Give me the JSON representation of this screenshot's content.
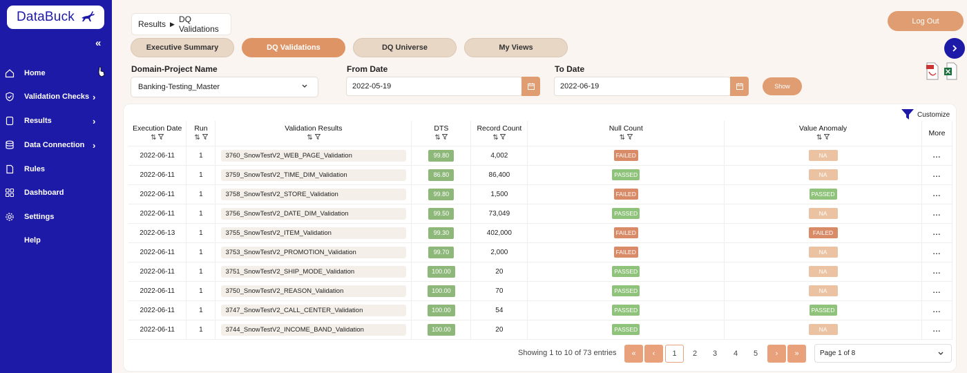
{
  "logo": {
    "text": "DataBuck"
  },
  "sidebar": {
    "items": [
      {
        "label": "Home",
        "has_chevron": false
      },
      {
        "label": "Validation Checks",
        "has_chevron": true
      },
      {
        "label": "Results",
        "has_chevron": true
      },
      {
        "label": "Data Connection",
        "has_chevron": true
      },
      {
        "label": "Rules",
        "has_chevron": false
      },
      {
        "label": "Dashboard",
        "has_chevron": false
      },
      {
        "label": "Settings",
        "has_chevron": false
      },
      {
        "label": "Help",
        "has_chevron": false
      }
    ],
    "collapse_glyph": "«",
    "chevron_glyph": "›"
  },
  "breadcrumb": {
    "parent": "Results",
    "current": "DQ Validations"
  },
  "header": {
    "logout_label": "Log Out"
  },
  "tabs": [
    {
      "label": "Executive Summary",
      "active": false
    },
    {
      "label": "DQ Validations",
      "active": true
    },
    {
      "label": "DQ Universe",
      "active": false
    },
    {
      "label": "My Views",
      "active": false
    }
  ],
  "filters": {
    "domain_label": "Domain-Project Name",
    "domain_value": "Banking-Testing_Master",
    "from_label": "From Date",
    "from_value": "2022-05-19",
    "to_label": "To Date",
    "to_value": "2022-06-19",
    "show_label": "Show"
  },
  "table": {
    "customize_label": "Customize",
    "columns": [
      "Execution Date",
      "Run",
      "Validation Results",
      "DTS",
      "Record Count",
      "Null Count",
      "Value Anomaly",
      "More"
    ],
    "sort_glyph": "⇅",
    "rows": [
      {
        "date": "2022-06-11",
        "run": "1",
        "name": "3760_SnowTestV2_WEB_PAGE_Validation",
        "dts": "99.80",
        "records": "4,002",
        "null": "FAILED",
        "anomaly": "NA",
        "more": "..."
      },
      {
        "date": "2022-06-11",
        "run": "1",
        "name": "3759_SnowTestV2_TIME_DIM_Validation",
        "dts": "86.80",
        "records": "86,400",
        "null": "PASSED",
        "anomaly": "NA",
        "more": "..."
      },
      {
        "date": "2022-06-11",
        "run": "1",
        "name": "3758_SnowTestV2_STORE_Validation",
        "dts": "99.80",
        "records": "1,500",
        "null": "FAILED",
        "anomaly": "PASSED",
        "more": "..."
      },
      {
        "date": "2022-06-11",
        "run": "1",
        "name": "3756_SnowTestV2_DATE_DIM_Validation",
        "dts": "99.50",
        "records": "73,049",
        "null": "PASSED",
        "anomaly": "NA",
        "more": "..."
      },
      {
        "date": "2022-06-13",
        "run": "1",
        "name": "3755_SnowTestV2_ITEM_Validation",
        "dts": "99.30",
        "records": "402,000",
        "null": "FAILED",
        "anomaly": "FAILED",
        "more": "..."
      },
      {
        "date": "2022-06-11",
        "run": "1",
        "name": "3753_SnowTestV2_PROMOTION_Validation",
        "dts": "99.70",
        "records": "2,000",
        "null": "FAILED",
        "anomaly": "NA",
        "more": "..."
      },
      {
        "date": "2022-06-11",
        "run": "1",
        "name": "3751_SnowTestV2_SHIP_MODE_Validation",
        "dts": "100.00",
        "records": "20",
        "null": "PASSED",
        "anomaly": "NA",
        "more": "..."
      },
      {
        "date": "2022-06-11",
        "run": "1",
        "name": "3750_SnowTestV2_REASON_Validation",
        "dts": "100.00",
        "records": "70",
        "null": "PASSED",
        "anomaly": "NA",
        "more": "..."
      },
      {
        "date": "2022-06-11",
        "run": "1",
        "name": "3747_SnowTestV2_CALL_CENTER_Validation",
        "dts": "100.00",
        "records": "54",
        "null": "PASSED",
        "anomaly": "PASSED",
        "more": "..."
      },
      {
        "date": "2022-06-11",
        "run": "1",
        "name": "3744_SnowTestV2_INCOME_BAND_Validation",
        "dts": "100.00",
        "records": "20",
        "null": "PASSED",
        "anomaly": "NA",
        "more": "..."
      }
    ]
  },
  "pagination": {
    "summary": "Showing 1 to 10 of 73 entries",
    "first_glyph": "«",
    "prev_glyph": "‹",
    "next_glyph": "›",
    "last_glyph": "»",
    "pages": [
      "1",
      "2",
      "3",
      "4",
      "5"
    ],
    "current_page": "1",
    "page_select": "Page 1 of 8"
  },
  "colors": {
    "sidebar_bg": "#1e1aa8",
    "accent": "#e09d72",
    "passed": "#8fc27a",
    "failed": "#d98a67",
    "na": "#ebc2a2",
    "dts": "#8eb879"
  }
}
